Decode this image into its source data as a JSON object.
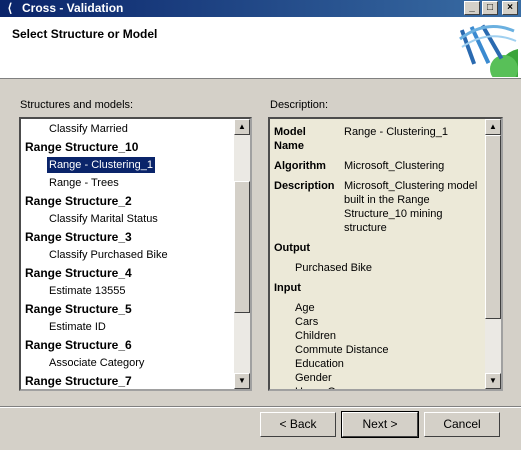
{
  "window": {
    "title": "Cross - Validation"
  },
  "header": {
    "title": "Select Structure or Model"
  },
  "left": {
    "label": "Structures and models:",
    "items": [
      {
        "text": "Classify Married",
        "kind": "child"
      },
      {
        "text": "Range Structure_10",
        "kind": "group"
      },
      {
        "text": "Range - Clustering_1",
        "kind": "child",
        "selected": true
      },
      {
        "text": "Range - Trees",
        "kind": "child"
      },
      {
        "text": "Range Structure_2",
        "kind": "group"
      },
      {
        "text": "Classify Marital Status",
        "kind": "child"
      },
      {
        "text": "Range Structure_3",
        "kind": "group"
      },
      {
        "text": "Classify Purchased Bike",
        "kind": "child"
      },
      {
        "text": "Range Structure_4",
        "kind": "group"
      },
      {
        "text": "Estimate 13555",
        "kind": "child"
      },
      {
        "text": "Range Structure_5",
        "kind": "group"
      },
      {
        "text": "Estimate ID",
        "kind": "child"
      },
      {
        "text": "Range Structure_6",
        "kind": "group"
      },
      {
        "text": "Associate Category",
        "kind": "child"
      },
      {
        "text": "Range Structure_7",
        "kind": "group"
      }
    ]
  },
  "right": {
    "label": "Description:",
    "model_name_label": "Model Name",
    "model_name": "Range - Clustering_1",
    "algorithm_label": "Algorithm",
    "algorithm": "Microsoft_Clustering",
    "description_label": "Description",
    "description": "Microsoft_Clustering model built in the Range Structure_10 mining structure",
    "output_label": "Output",
    "outputs": [
      "Purchased Bike"
    ],
    "input_label": "Input",
    "inputs": [
      "Age",
      "Cars",
      "Children",
      "Commute Distance",
      "Education",
      "Gender",
      "Home Owner"
    ]
  },
  "buttons": {
    "back": "< Back",
    "next": "Next >",
    "cancel": "Cancel"
  }
}
